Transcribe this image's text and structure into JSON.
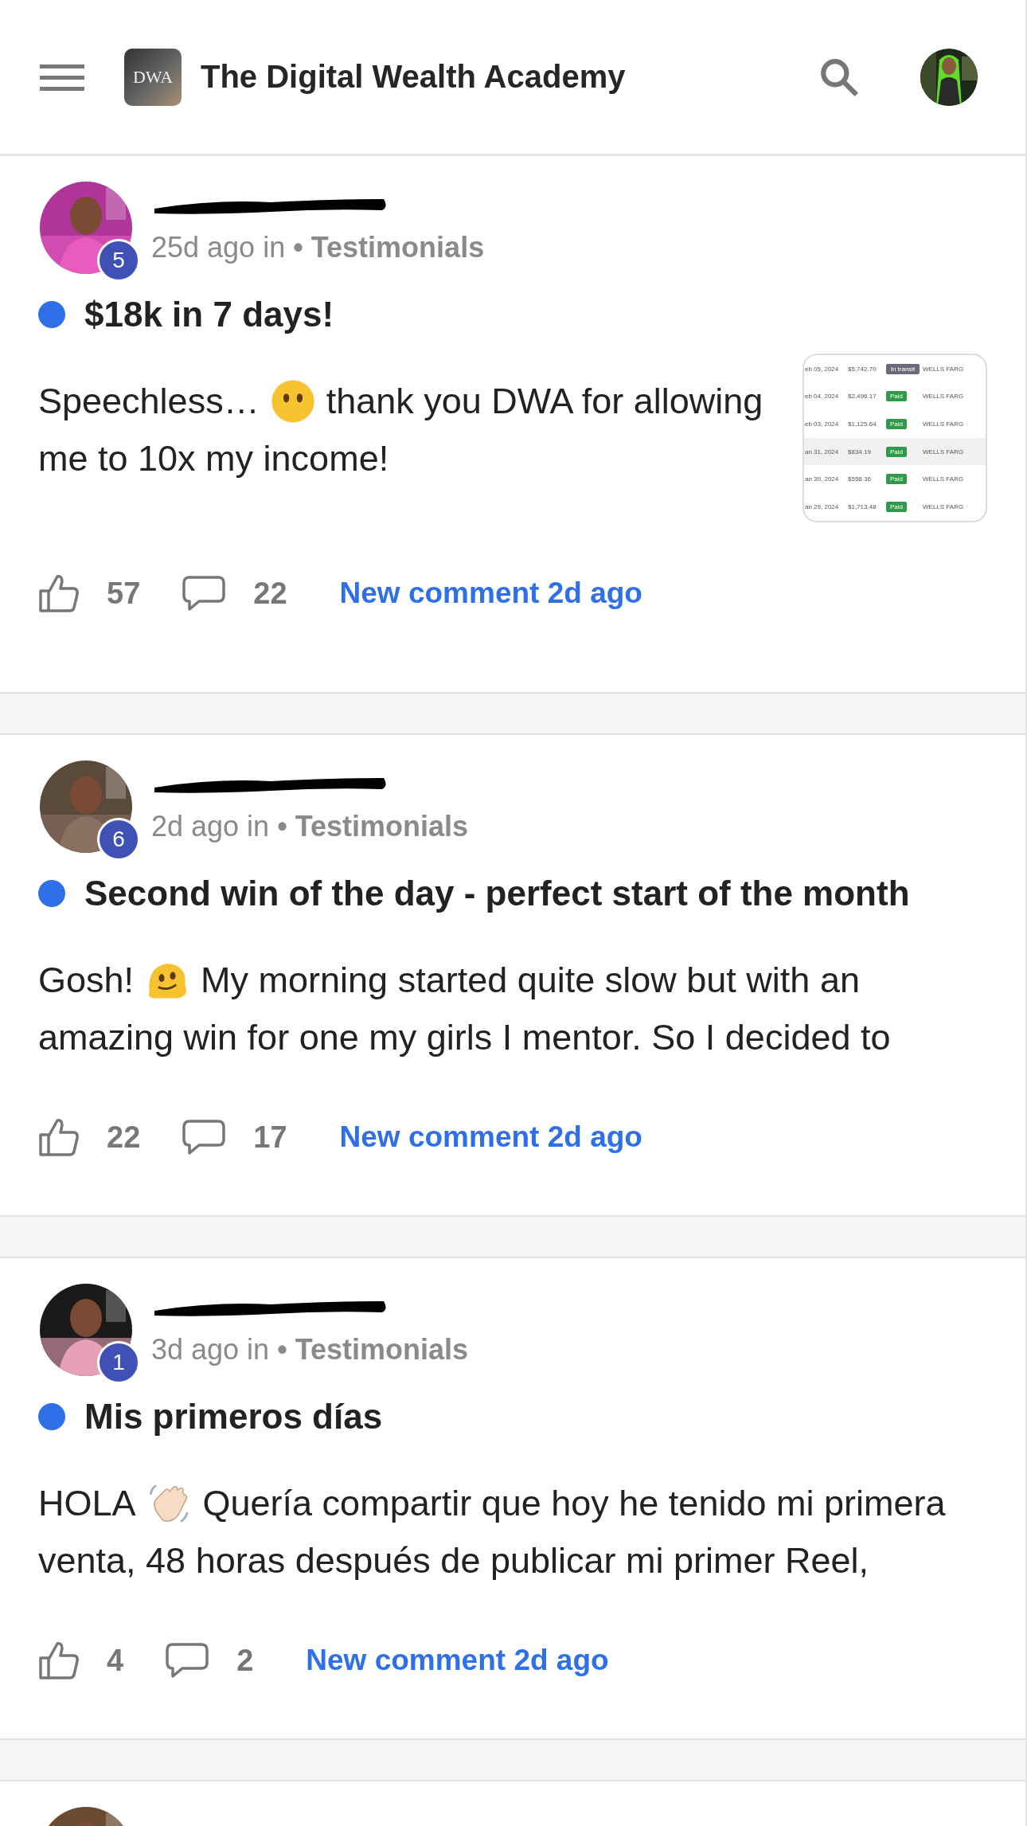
{
  "header": {
    "logo_text": "DWA",
    "title": "The Digital Wealth Academy"
  },
  "posts": [
    {
      "avatar": {
        "kind": "picture"
      },
      "redacted": true,
      "level_badge": "5",
      "time": "25d ago in",
      "category": "• Testimonials",
      "unread": true,
      "title": "$18k in 7 days!",
      "body": [
        [
          {
            "kind": "text",
            "text": "Speechless…"
          },
          {
            "kind": "emoji"
          },
          {
            "kind": "text",
            "text": "thank you DWA for allowing"
          }
        ],
        [
          {
            "kind": "text",
            "text": "me to 10x my income!"
          }
        ]
      ],
      "thumbnail": {
        "rows": [
          {
            "date": "eb 05, 2024",
            "amount": "$5,742.70",
            "status": "In transit",
            "kind": "pending",
            "bank": "WELLS FARG"
          },
          {
            "date": "eb 04, 2024",
            "amount": "$2,496.17",
            "status": "Paid",
            "kind": "paid",
            "bank": "WELLS FARG"
          },
          {
            "date": "eb 03, 2024",
            "amount": "$1,125.64",
            "status": "Paid",
            "kind": "paid",
            "bank": "WELLS FARG"
          },
          {
            "date": "an 31, 2024",
            "amount": "$834.19",
            "status": "Paid",
            "kind": "paid",
            "bank": "WELLS FARG"
          },
          {
            "date": "an 30, 2024",
            "amount": "$558.36",
            "status": "Paid",
            "kind": "paid",
            "bank": "WELLS FARG"
          },
          {
            "date": "an 29, 2024",
            "amount": "$1,713.48",
            "status": "Paid",
            "kind": "paid",
            "bank": "WELLS FARG"
          }
        ]
      },
      "likes": "57",
      "comments": "22",
      "activity": "New comment 2d ago"
    },
    {
      "avatar": {
        "kind": "picture"
      },
      "redacted": true,
      "level_badge": "6",
      "time": "2d ago in",
      "category": "• Testimonials",
      "unread": true,
      "title": "Second win of the day - perfect start of the month",
      "body": [
        [
          {
            "kind": "text",
            "text": "Gosh!"
          },
          {
            "kind": "emoji"
          },
          {
            "kind": "text",
            "text": "My morning started quite slow but with an"
          }
        ],
        [
          {
            "kind": "text",
            "text": "amazing win for one my girls I mentor. So I decided to"
          }
        ]
      ],
      "likes": "22",
      "comments": "17",
      "activity": "New comment 2d ago"
    },
    {
      "avatar": {
        "kind": "picture"
      },
      "redacted": true,
      "level_badge": "1",
      "time": "3d ago in",
      "category": "• Testimonials",
      "unread": true,
      "title": "Mis primeros días",
      "body": [
        [
          {
            "kind": "text",
            "text": "HOLA"
          },
          {
            "kind": "emoji"
          },
          {
            "kind": "text",
            "text": "Quería compartir que hoy he tenido mi primera"
          }
        ],
        [
          {
            "kind": "text",
            "text": "venta, 48 horas después de publicar mi primer Reel,"
          }
        ]
      ],
      "likes": "4",
      "comments": "2",
      "activity": "New comment 2d ago"
    },
    {
      "avatar": {
        "kind": "picture"
      }
    }
  ]
}
